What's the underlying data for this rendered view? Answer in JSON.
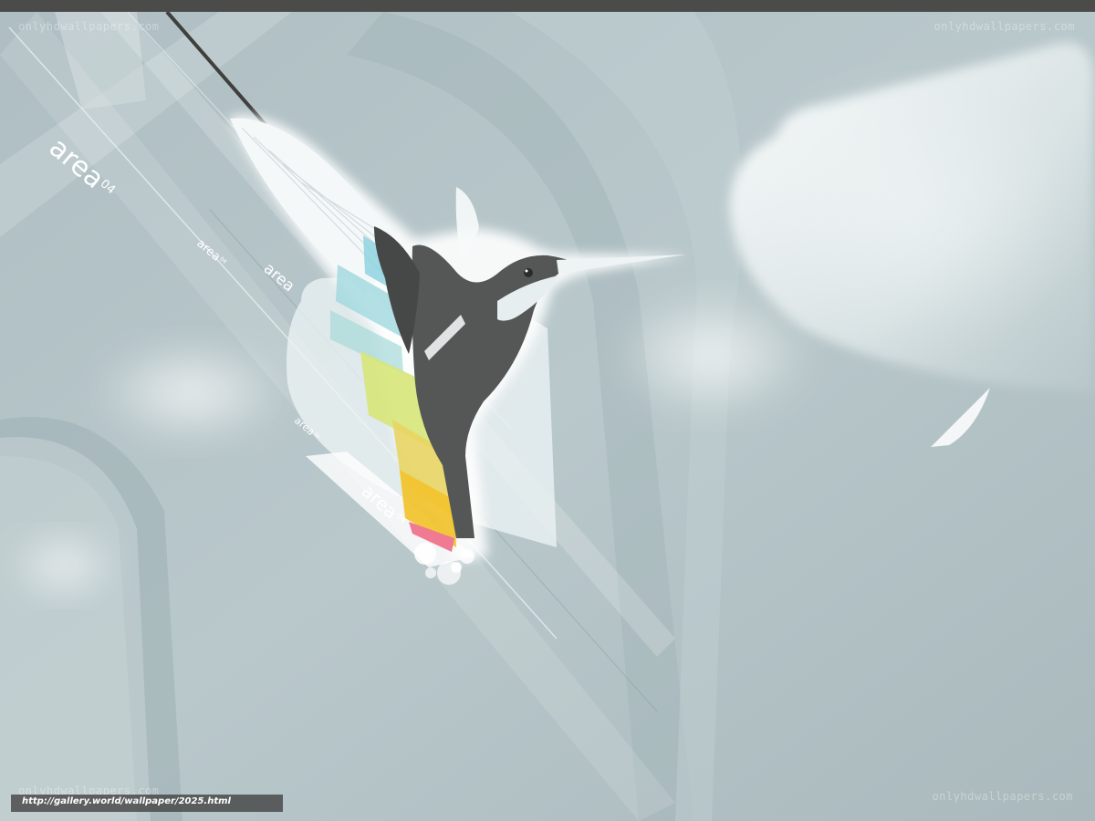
{
  "watermarks": {
    "top_left": "onlyhdwallpapers.com",
    "top_right": "onlyhdwallpapers.com",
    "bottom_right": "onlyhdwallpapers.com",
    "bottom_left": "onlyhdwallpapers.com"
  },
  "url": "http://gallery.world/wallpaper/2025.html",
  "logos": {
    "large": "area",
    "large_suffix": "04",
    "small": "area",
    "small_suffix": "04"
  },
  "colors": {
    "background": "#b3c3c6",
    "top_bar": "#4b4b49",
    "bird_body": "#555757",
    "wing_white": "#ffffff",
    "stripe_blue": "#8ed3e0",
    "stripe_green": "#dbe87a",
    "stripe_yellow": "#f2c431",
    "stripe_pink": "#ef7a92"
  }
}
